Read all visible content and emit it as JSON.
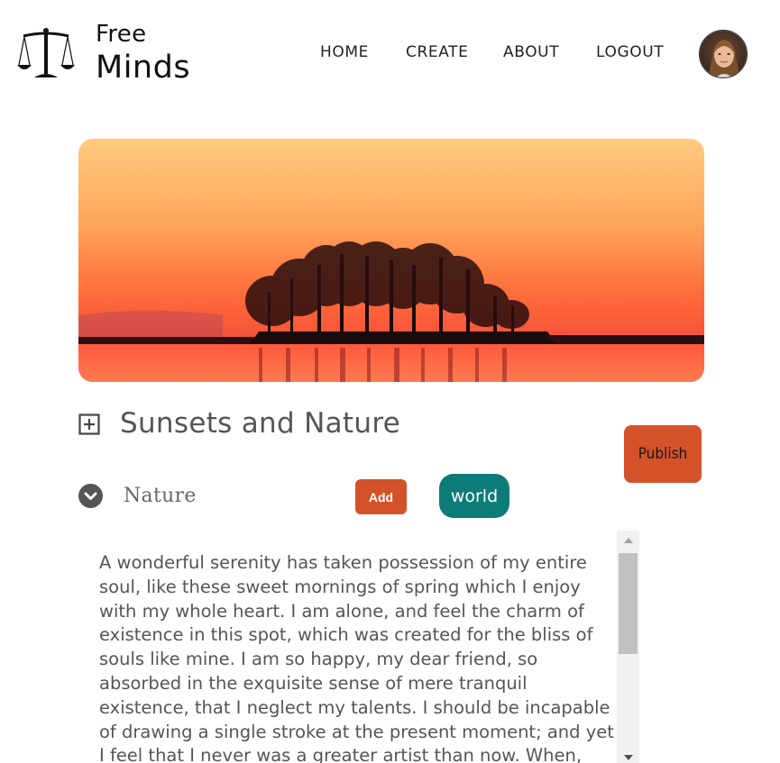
{
  "brand": {
    "line1": "Free",
    "line2": "Minds"
  },
  "nav": {
    "home": "HOME",
    "create": "CREATE",
    "about": "ABOUT",
    "logout": "LOGOUT"
  },
  "post": {
    "title": "Sunsets and Nature",
    "category": "Nature",
    "add_label": "Add",
    "tag": "world",
    "publish_label": "Publish",
    "body": "A wonderful serenity has taken possession of my entire soul, like these sweet mornings of spring which I enjoy with my whole heart. I am alone, and feel the charm of existence in this spot, which was created for the bliss of souls like mine. I am so happy, my dear friend, so absorbed in the exquisite sense of mere tranquil existence, that I neglect my talents. I should be incapable of drawing a single stroke at the present moment; and yet I feel that I never was a greater artist than now. When, while the lovely valley teems with vapour around"
  },
  "colors": {
    "accent": "#d4522a",
    "tag": "#0d7c78",
    "text": "#555555"
  },
  "icons": {
    "logo": "scales-of-justice-icon",
    "expand": "plus-square-icon",
    "category_toggle": "chevron-down-circle-icon"
  }
}
